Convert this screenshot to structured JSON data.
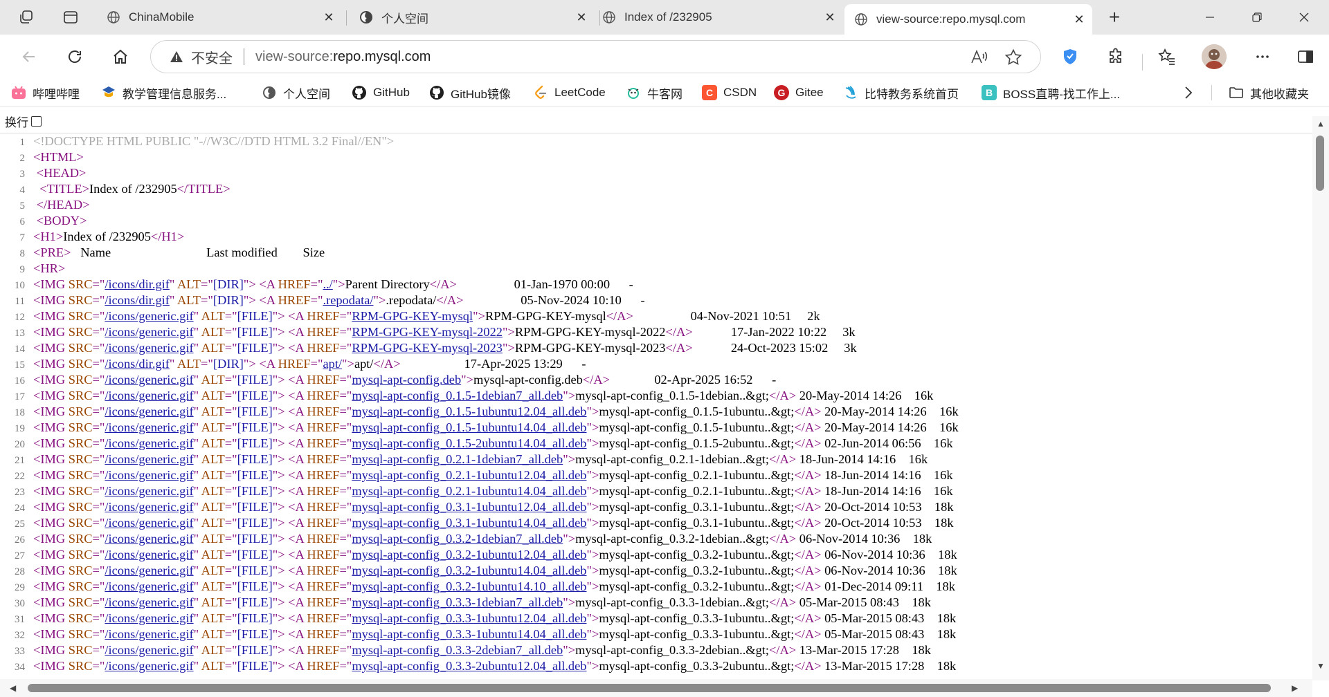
{
  "browser": {
    "tabs": [
      {
        "title": "ChinaMobile",
        "active": false
      },
      {
        "title": "个人空间",
        "active": false
      },
      {
        "title": "Index of /232905",
        "active": false
      },
      {
        "title": "view-source:repo.mysql.com",
        "active": true
      }
    ],
    "new_tab_label": "+",
    "security_label": "不安全",
    "url_prefix": "view-source:",
    "url_host": "repo.mysql.com",
    "bookmarks": [
      {
        "label": "哔哩哔哩",
        "icon": "bilibili-icon",
        "color": "#fb7299"
      },
      {
        "label": "教学管理信息服务...",
        "icon": "school-icon",
        "color": "#2a5db0"
      },
      {
        "label": "个人空间",
        "icon": "globe-icon",
        "color": "#555555"
      },
      {
        "label": "GitHub",
        "icon": "github-icon",
        "color": "#1f1f1f"
      },
      {
        "label": "GitHub镜像",
        "icon": "github-icon",
        "color": "#1f1f1f"
      },
      {
        "label": "LeetCode",
        "icon": "leetcode-icon",
        "color": "#f89f1b"
      },
      {
        "label": "牛客网",
        "icon": "nowcoder-icon",
        "color": "#25bb9b"
      },
      {
        "label": "CSDN",
        "icon": "csdn-icon",
        "color": "#fc5531"
      },
      {
        "label": "Gitee",
        "icon": "gitee-icon",
        "color": "#c71d23"
      },
      {
        "label": "比特教务系统首页",
        "icon": "bit-icon",
        "color": "#20a0d8"
      },
      {
        "label": "BOSS直聘-找工作上...",
        "icon": "boss-icon",
        "color": "#3cc1c1"
      }
    ],
    "other_bookmarks": "其他收藏夹"
  },
  "viewer": {
    "wrap_label": "换行"
  },
  "source_lines": [
    {
      "n": "1",
      "t": "doctype",
      "text": "<!DOCTYPE HTML PUBLIC \"-//W3C//DTD HTML 3.2 Final//EN\">"
    },
    {
      "n": "2",
      "t": "tag",
      "text": "<HTML>"
    },
    {
      "n": "3",
      "t": "tag",
      "text": " <HEAD>"
    },
    {
      "n": "4",
      "t": "title",
      "text": "Index of /232905"
    },
    {
      "n": "5",
      "t": "tag",
      "text": " </HEAD>"
    },
    {
      "n": "6",
      "t": "tag",
      "text": " <BODY>"
    },
    {
      "n": "7",
      "t": "h1",
      "text": "Index of /232905"
    },
    {
      "n": "8",
      "t": "pre",
      "text": "   Name                              Last modified        Size"
    },
    {
      "n": "9",
      "t": "tag",
      "text": "<HR>"
    },
    {
      "n": "10",
      "t": "row",
      "icon": "/icons/dir.gif",
      "alt": "[DIR]",
      "href": "../",
      "label": "Parent Directory",
      "sp": "      ",
      "tail": "                  01-Jan-1970 00:00      -"
    },
    {
      "n": "11",
      "t": "row",
      "icon": "/icons/dir.gif",
      "alt": "[DIR]",
      "href": ".repodata/",
      "label": ".repodata/",
      "sp": "      ",
      "tail": "                  05-Nov-2024 10:10      -"
    },
    {
      "n": "12",
      "t": "row",
      "icon": "/icons/generic.gif",
      "alt": "[FILE]",
      "href": "RPM-GPG-KEY-mysql",
      "label": "RPM-GPG-KEY-mysql",
      "sp": "  ",
      "tail": "                  04-Nov-2021 10:51     2k"
    },
    {
      "n": "13",
      "t": "row",
      "icon": "/icons/generic.gif",
      "alt": "[FILE]",
      "href": "RPM-GPG-KEY-mysql-2022",
      "label": "RPM-GPG-KEY-mysql-2022",
      "sp": "  ",
      "tail": "            17-Jan-2022 10:22     3k"
    },
    {
      "n": "14",
      "t": "row",
      "icon": "/icons/generic.gif",
      "alt": "[FILE]",
      "href": "RPM-GPG-KEY-mysql-2023",
      "label": "RPM-GPG-KEY-mysql-2023",
      "sp": "  ",
      "tail": "            24-Oct-2023 15:02     3k"
    },
    {
      "n": "15",
      "t": "row",
      "icon": "/icons/dir.gif",
      "alt": "[DIR]",
      "href": "apt/",
      "label": "apt/",
      "sp": "      ",
      "tail": "                    17-Apr-2025 13:29      -"
    },
    {
      "n": "16",
      "t": "row",
      "icon": "/icons/generic.gif",
      "alt": "[FILE]",
      "href": "mysql-apt-config.deb",
      "label": "mysql-apt-config.deb",
      "sp": "  ",
      "tail": "              02-Apr-2025 16:52      -"
    },
    {
      "n": "17",
      "t": "row",
      "icon": "/icons/generic.gif",
      "alt": "[FILE]",
      "href": "mysql-apt-config_0.1.5-1debian7_all.deb",
      "label": "mysql-apt-config_0.1.5-1debian..&gt;",
      "sp": "  ",
      "tail": " 20-May-2014 14:26    16k"
    },
    {
      "n": "18",
      "t": "row",
      "icon": "/icons/generic.gif",
      "alt": "[FILE]",
      "href": "mysql-apt-config_0.1.5-1ubuntu12.04_all.deb",
      "label": "mysql-apt-config_0.1.5-1ubuntu..&gt;",
      "sp": "  ",
      "tail": " 20-May-2014 14:26    16k"
    },
    {
      "n": "19",
      "t": "row",
      "icon": "/icons/generic.gif",
      "alt": "[FILE]",
      "href": "mysql-apt-config_0.1.5-1ubuntu14.04_all.deb",
      "label": "mysql-apt-config_0.1.5-1ubuntu..&gt;",
      "sp": "  ",
      "tail": " 20-May-2014 14:26    16k"
    },
    {
      "n": "20",
      "t": "row",
      "icon": "/icons/generic.gif",
      "alt": "[FILE]",
      "href": "mysql-apt-config_0.1.5-2ubuntu14.04_all.deb",
      "label": "mysql-apt-config_0.1.5-2ubuntu..&gt;",
      "sp": "  ",
      "tail": " 02-Jun-2014 06:56    16k"
    },
    {
      "n": "21",
      "t": "row",
      "icon": "/icons/generic.gif",
      "alt": "[FILE]",
      "href": "mysql-apt-config_0.2.1-1debian7_all.deb",
      "label": "mysql-apt-config_0.2.1-1debian..&gt;",
      "sp": "  ",
      "tail": " 18-Jun-2014 14:16    16k"
    },
    {
      "n": "22",
      "t": "row",
      "icon": "/icons/generic.gif",
      "alt": "[FILE]",
      "href": "mysql-apt-config_0.2.1-1ubuntu12.04_all.deb",
      "label": "mysql-apt-config_0.2.1-1ubuntu..&gt;",
      "sp": "  ",
      "tail": " 18-Jun-2014 14:16    16k"
    },
    {
      "n": "23",
      "t": "row",
      "icon": "/icons/generic.gif",
      "alt": "[FILE]",
      "href": "mysql-apt-config_0.2.1-1ubuntu14.04_all.deb",
      "label": "mysql-apt-config_0.2.1-1ubuntu..&gt;",
      "sp": "  ",
      "tail": " 18-Jun-2014 14:16    16k"
    },
    {
      "n": "24",
      "t": "row",
      "icon": "/icons/generic.gif",
      "alt": "[FILE]",
      "href": "mysql-apt-config_0.3.1-1ubuntu12.04_all.deb",
      "label": "mysql-apt-config_0.3.1-1ubuntu..&gt;",
      "sp": "  ",
      "tail": " 20-Oct-2014 10:53    18k"
    },
    {
      "n": "25",
      "t": "row",
      "icon": "/icons/generic.gif",
      "alt": "[FILE]",
      "href": "mysql-apt-config_0.3.1-1ubuntu14.04_all.deb",
      "label": "mysql-apt-config_0.3.1-1ubuntu..&gt;",
      "sp": "  ",
      "tail": " 20-Oct-2014 10:53    18k"
    },
    {
      "n": "26",
      "t": "row",
      "icon": "/icons/generic.gif",
      "alt": "[FILE]",
      "href": "mysql-apt-config_0.3.2-1debian7_all.deb",
      "label": "mysql-apt-config_0.3.2-1debian..&gt;",
      "sp": "  ",
      "tail": " 06-Nov-2014 10:36    18k"
    },
    {
      "n": "27",
      "t": "row",
      "icon": "/icons/generic.gif",
      "alt": "[FILE]",
      "href": "mysql-apt-config_0.3.2-1ubuntu12.04_all.deb",
      "label": "mysql-apt-config_0.3.2-1ubuntu..&gt;",
      "sp": "  ",
      "tail": " 06-Nov-2014 10:36    18k"
    },
    {
      "n": "28",
      "t": "row",
      "icon": "/icons/generic.gif",
      "alt": "[FILE]",
      "href": "mysql-apt-config_0.3.2-1ubuntu14.04_all.deb",
      "label": "mysql-apt-config_0.3.2-1ubuntu..&gt;",
      "sp": "  ",
      "tail": " 06-Nov-2014 10:36    18k"
    },
    {
      "n": "29",
      "t": "row",
      "icon": "/icons/generic.gif",
      "alt": "[FILE]",
      "href": "mysql-apt-config_0.3.2-1ubuntu14.10_all.deb",
      "label": "mysql-apt-config_0.3.2-1ubuntu..&gt;",
      "sp": "  ",
      "tail": " 01-Dec-2014 09:11    18k"
    },
    {
      "n": "30",
      "t": "row",
      "icon": "/icons/generic.gif",
      "alt": "[FILE]",
      "href": "mysql-apt-config_0.3.3-1debian7_all.deb",
      "label": "mysql-apt-config_0.3.3-1debian..&gt;",
      "sp": "  ",
      "tail": " 05-Mar-2015 08:43    18k"
    },
    {
      "n": "31",
      "t": "row",
      "icon": "/icons/generic.gif",
      "alt": "[FILE]",
      "href": "mysql-apt-config_0.3.3-1ubuntu12.04_all.deb",
      "label": "mysql-apt-config_0.3.3-1ubuntu..&gt;",
      "sp": "  ",
      "tail": " 05-Mar-2015 08:43    18k"
    },
    {
      "n": "32",
      "t": "row",
      "icon": "/icons/generic.gif",
      "alt": "[FILE]",
      "href": "mysql-apt-config_0.3.3-1ubuntu14.04_all.deb",
      "label": "mysql-apt-config_0.3.3-1ubuntu..&gt;",
      "sp": "  ",
      "tail": " 05-Mar-2015 08:43    18k"
    },
    {
      "n": "33",
      "t": "row",
      "icon": "/icons/generic.gif",
      "alt": "[FILE]",
      "href": "mysql-apt-config_0.3.3-2debian7_all.deb",
      "label": "mysql-apt-config_0.3.3-2debian..&gt;",
      "sp": "  ",
      "tail": " 13-Mar-2015 17:28    18k"
    },
    {
      "n": "34",
      "t": "row",
      "icon": "/icons/generic.gif",
      "alt": "[FILE]",
      "href": "mysql-apt-config_0.3.3-2ubuntu12.04_all.deb",
      "label": "mysql-apt-config_0.3.3-2ubuntu..&gt;",
      "sp": "  ",
      "tail": " 13-Mar-2015 17:28    18k"
    }
  ],
  "colors": {
    "tag": "#881280",
    "attribute": "#994500",
    "value": "#1a1aa6",
    "doctype": "#aaaaaa",
    "tabstrip": "#e8e8e8"
  }
}
